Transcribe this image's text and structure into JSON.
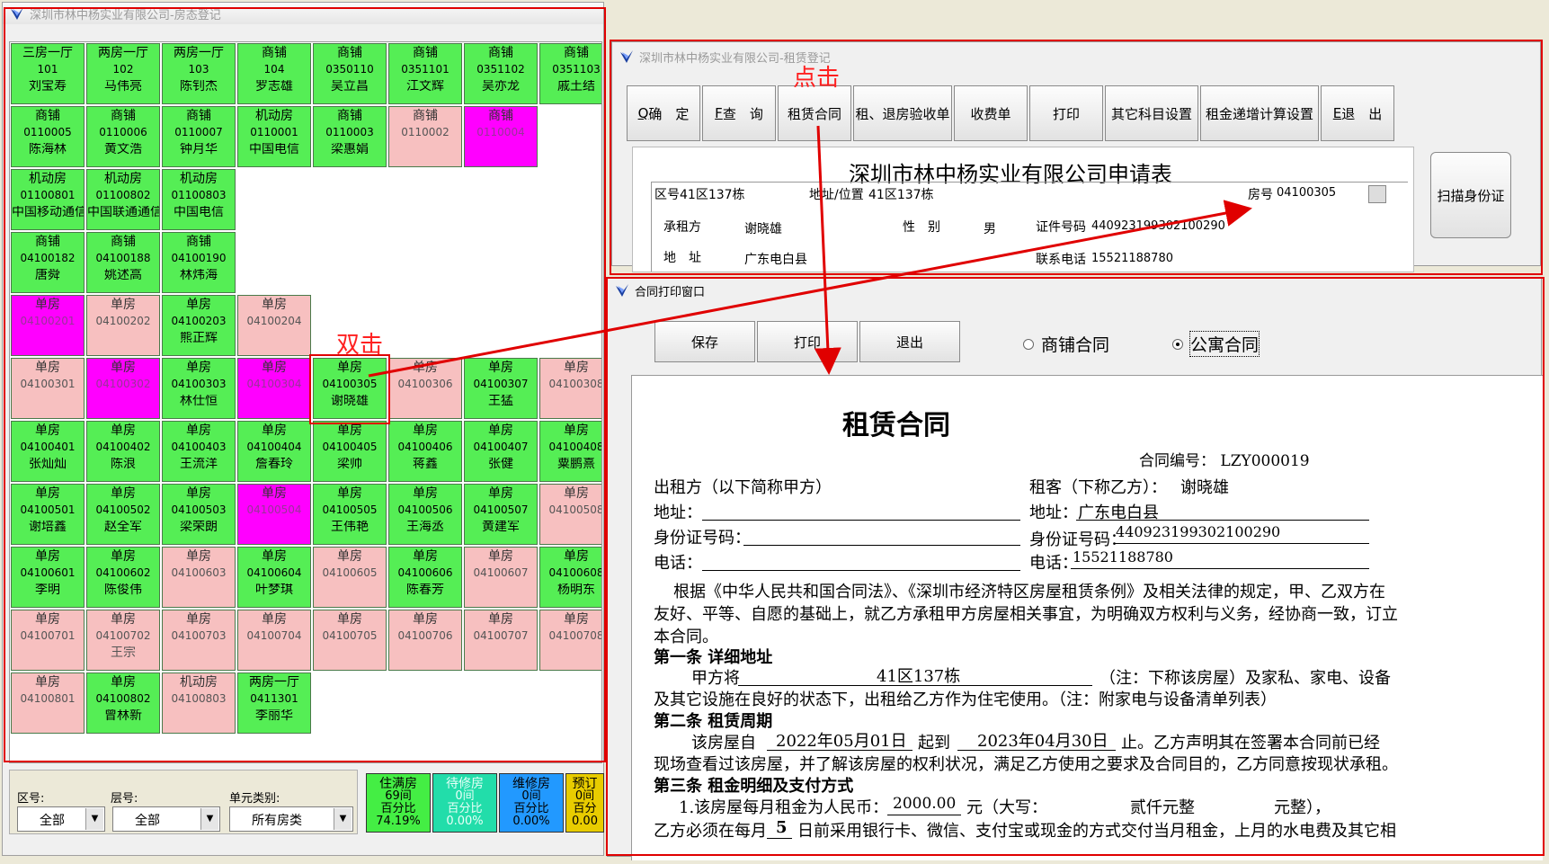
{
  "left_window": {
    "title": "深圳市林中杨实业有限公司-房态登记",
    "units": [
      {
        "type": "三房一厅",
        "num": "101",
        "person": "刘宝寿",
        "status": "g"
      },
      {
        "type": "两房一厅",
        "num": "102",
        "person": "马伟亮",
        "status": "g"
      },
      {
        "type": "两房一厅",
        "num": "103",
        "person": "陈钊杰",
        "status": "g"
      },
      {
        "type": "商铺",
        "num": "104",
        "person": "罗志雄",
        "status": "g"
      },
      {
        "type": "商铺",
        "num": "0350110",
        "person": "吴立昌",
        "status": "g"
      },
      {
        "type": "商铺",
        "num": "0351101",
        "person": "江文辉",
        "status": "g"
      },
      {
        "type": "商铺",
        "num": "0351102",
        "person": "吴亦龙",
        "status": "g"
      },
      {
        "type": "商铺",
        "num": "0351103",
        "person": "戚土结",
        "status": "g"
      },
      {
        "type": "商铺",
        "num": "0110005",
        "person": "陈海林",
        "status": "g"
      },
      {
        "type": "商铺",
        "num": "0110006",
        "person": "黄文浩",
        "status": "g"
      },
      {
        "type": "商铺",
        "num": "0110007",
        "person": "钟月华",
        "status": "g"
      },
      {
        "type": "机动房",
        "num": "0110001",
        "person": "中国电信",
        "status": "g"
      },
      {
        "type": "商铺",
        "num": "0110003",
        "person": "梁惠娟",
        "status": "g"
      },
      {
        "type": "商铺",
        "num": "0110002",
        "person": "",
        "status": "k"
      },
      {
        "type": "商铺",
        "num": "0110004",
        "person": "",
        "status": "m"
      },
      {
        "type": "机动房",
        "num": "01100801",
        "person": "中国移动通信",
        "status": "g"
      },
      {
        "type": "机动房",
        "num": "01100802",
        "person": "中国联通通信",
        "status": "g"
      },
      {
        "type": "机动房",
        "num": "01100803",
        "person": "中国电信",
        "status": "g"
      },
      {
        "type": "商铺",
        "num": "04100182",
        "person": "唐舜",
        "status": "g"
      },
      {
        "type": "商铺",
        "num": "04100188",
        "person": "姚述高",
        "status": "g"
      },
      {
        "type": "商铺",
        "num": "04100190",
        "person": "林炜海",
        "status": "g"
      },
      {
        "type": "单房",
        "num": "04100201",
        "person": "",
        "status": "m"
      },
      {
        "type": "单房",
        "num": "04100202",
        "person": "",
        "status": "k"
      },
      {
        "type": "单房",
        "num": "04100203",
        "person": "熊正辉",
        "status": "g"
      },
      {
        "type": "单房",
        "num": "04100204",
        "person": "",
        "status": "k"
      },
      {
        "type": "单房",
        "num": "04100301",
        "person": "",
        "status": "k"
      },
      {
        "type": "单房",
        "num": "04100302",
        "person": "",
        "status": "m"
      },
      {
        "type": "单房",
        "num": "04100303",
        "person": "林仕恒",
        "status": "g"
      },
      {
        "type": "单房",
        "num": "04100304",
        "person": "",
        "status": "m"
      },
      {
        "type": "单房",
        "num": "04100305",
        "person": "谢晓雄",
        "status": "g"
      },
      {
        "type": "单房",
        "num": "04100306",
        "person": "",
        "status": "k"
      },
      {
        "type": "单房",
        "num": "04100307",
        "person": "王猛",
        "status": "g"
      },
      {
        "type": "单房",
        "num": "04100308",
        "person": "",
        "status": "k"
      },
      {
        "type": "单房",
        "num": "04100401",
        "person": "张灿灿",
        "status": "g"
      },
      {
        "type": "单房",
        "num": "04100402",
        "person": "陈浪",
        "status": "g"
      },
      {
        "type": "单房",
        "num": "04100403",
        "person": "王流洋",
        "status": "g"
      },
      {
        "type": "单房",
        "num": "04100404",
        "person": "詹春玲",
        "status": "g"
      },
      {
        "type": "单房",
        "num": "04100405",
        "person": "梁帅",
        "status": "g"
      },
      {
        "type": "单房",
        "num": "04100406",
        "person": "蒋鑫",
        "status": "g"
      },
      {
        "type": "单房",
        "num": "04100407",
        "person": "张健",
        "status": "g"
      },
      {
        "type": "单房",
        "num": "04100408",
        "person": "粟鹏熹",
        "status": "g"
      },
      {
        "type": "单房",
        "num": "04100501",
        "person": "谢培鑫",
        "status": "g"
      },
      {
        "type": "单房",
        "num": "04100502",
        "person": "赵全军",
        "status": "g"
      },
      {
        "type": "单房",
        "num": "04100503",
        "person": "梁荣朗",
        "status": "g"
      },
      {
        "type": "单房",
        "num": "04100504",
        "person": "",
        "status": "m"
      },
      {
        "type": "单房",
        "num": "04100505",
        "person": "王伟艳",
        "status": "g"
      },
      {
        "type": "单房",
        "num": "04100506",
        "person": "王海丞",
        "status": "g"
      },
      {
        "type": "单房",
        "num": "04100507",
        "person": "黄建军",
        "status": "g"
      },
      {
        "type": "单房",
        "num": "04100508",
        "person": "",
        "status": "k"
      },
      {
        "type": "单房",
        "num": "04100601",
        "person": "李明",
        "status": "g"
      },
      {
        "type": "单房",
        "num": "04100602",
        "person": "陈俊伟",
        "status": "g"
      },
      {
        "type": "单房",
        "num": "04100603",
        "person": "",
        "status": "k"
      },
      {
        "type": "单房",
        "num": "04100604",
        "person": "叶梦琪",
        "status": "g"
      },
      {
        "type": "单房",
        "num": "04100605",
        "person": "",
        "status": "k"
      },
      {
        "type": "单房",
        "num": "04100606",
        "person": "陈春芳",
        "status": "g"
      },
      {
        "type": "单房",
        "num": "04100607",
        "person": "",
        "status": "k"
      },
      {
        "type": "单房",
        "num": "04100608",
        "person": "杨明东",
        "status": "g"
      },
      {
        "type": "单房",
        "num": "04100701",
        "person": "",
        "status": "k"
      },
      {
        "type": "单房",
        "num": "04100702",
        "person": "王宗",
        "status": "k"
      },
      {
        "type": "单房",
        "num": "04100703",
        "person": "",
        "status": "k"
      },
      {
        "type": "单房",
        "num": "04100704",
        "person": "",
        "status": "k"
      },
      {
        "type": "单房",
        "num": "04100705",
        "person": "",
        "status": "k"
      },
      {
        "type": "单房",
        "num": "04100706",
        "person": "",
        "status": "k"
      },
      {
        "type": "单房",
        "num": "04100707",
        "person": "",
        "status": "k"
      },
      {
        "type": "单房",
        "num": "04100708",
        "person": "",
        "status": "k"
      },
      {
        "type": "单房",
        "num": "04100801",
        "person": "",
        "status": "k"
      },
      {
        "type": "单房",
        "num": "04100802",
        "person": "曾林新",
        "status": "g"
      },
      {
        "type": "机动房",
        "num": "04100803",
        "person": "",
        "status": "k"
      },
      {
        "type": "两房一厅",
        "num": "0411301",
        "person": "李丽华",
        "status": "g"
      }
    ],
    "filters": {
      "zone_label": "区号:",
      "zone_value": "全部",
      "floor_label": "层号:",
      "floor_value": "全部",
      "category_label": "单元类别:",
      "category_value": "所有房类"
    },
    "stats": [
      {
        "name": "住满房",
        "count": "69间",
        "label": "百分比",
        "pct": "74.19%",
        "color": "#44ee44"
      },
      {
        "name": "待修房",
        "count": "0间",
        "label": "百分比",
        "pct": "0.00%",
        "color": "#22ddaa"
      },
      {
        "name": "维修房",
        "count": "0间",
        "label": "百分比",
        "pct": "0.00%",
        "color": "#2299ff"
      },
      {
        "name": "预订",
        "count": "0间",
        "label": "百分",
        "pct": "0.00",
        "color": "#e8cc00"
      }
    ]
  },
  "lease_window": {
    "title": "深圳市林中杨实业有限公司-租赁登记",
    "buttons": {
      "confirm": "确　定",
      "confirm_key": "Q",
      "query": "查　询",
      "query_key": "F",
      "lease": "租赁合同",
      "inspect": "租、退房验收单",
      "fee": "收费单",
      "print": "打印",
      "other": "其它科目设置",
      "increase": "租金递增计算设置",
      "exit": "退　出",
      "exit_key": "E"
    },
    "form": {
      "heading": "深圳市林中杨实业有限公司申请表",
      "zone_label": "区号",
      "zone_value": "41区137栋",
      "addr_label": "地址/位置",
      "addr_value": "41区137栋",
      "room_label": "房号",
      "room_value": "04100305",
      "tenant_label": "承租方",
      "tenant_value": "谢晓雄",
      "gender_label": "性　别",
      "gender_value": "男",
      "id_label": "证件号码",
      "id_value": "440923199302100290",
      "address_label": "地　址",
      "address_value": "广东电白县",
      "phone_label": "联系电话",
      "phone_value": "15521188780"
    },
    "scan_button": "扫描身份证"
  },
  "print_window": {
    "title": "合同打印窗口",
    "save": "保存",
    "print": "打印",
    "exit": "退出",
    "radio_shop": "商铺合同",
    "radio_apt": "公寓合同"
  },
  "contract": {
    "title": "租赁合同",
    "number": "合同编号： LZY000019",
    "landlord": "出租方（以下简称甲方）",
    "tenant_label": "租客（下称乙方）：",
    "tenant": "谢晓雄",
    "addr_label": "地址：",
    "tenant_addr": "广东电白县",
    "id_label": "身份证号码：",
    "tenant_id": "440923199302100290",
    "phone_label": "电话：",
    "tenant_phone": "15521188780",
    "para1_l1": "根据《中华人民共和国合同法》、《深圳市经济特区房屋租赁条例》及相关法律的规定，甲、乙双方在",
    "para1_l2": "友好、平等、自愿的基础上，就乙方承租甲方房屋相关事宜，为明确双方权利与义务，经协商一致，订立",
    "para1_l3": "本合同。",
    "art1": "第一条  详细地址",
    "art1_l1a": "甲方将",
    "art1_addr": "41区137栋",
    "art1_l1b": "（注：下称该房屋）及家私、家电、设备",
    "art1_l2": "及其它设施在良好的状态下，出租给乙方作为住宅使用。（注：附家电与设备清单列表）",
    "art2": "第二条  租赁周期",
    "art2_a": "该房屋自",
    "start_date": "2022年05月01日",
    "art2_b": "起到",
    "end_date": "2023年04月30日",
    "art2_c": "止。乙方声明其在签署本合同前已经",
    "art2_l2": "现场查看过该房屋，并了解该房屋的权利状况，满足乙方使用之要求及合同目的，乙方同意按现状承租。",
    "art3": "第三条  租金明细及支付方式",
    "art3_a": "1.该房屋每月租金为人民币：",
    "rent": "2000.00",
    "art3_b": "元（大写：",
    "rent_cn": "贰仟元整",
    "art3_c": "元整），",
    "art3_l2a": "乙方必须在每月",
    "pay_day": "5",
    "art3_l2b": "日前采用银行卡、微信、支付宝或现金的方式交付当月租金，上月的水电费及其它相"
  },
  "annotations": {
    "double_click": "双击",
    "click": "点击"
  }
}
